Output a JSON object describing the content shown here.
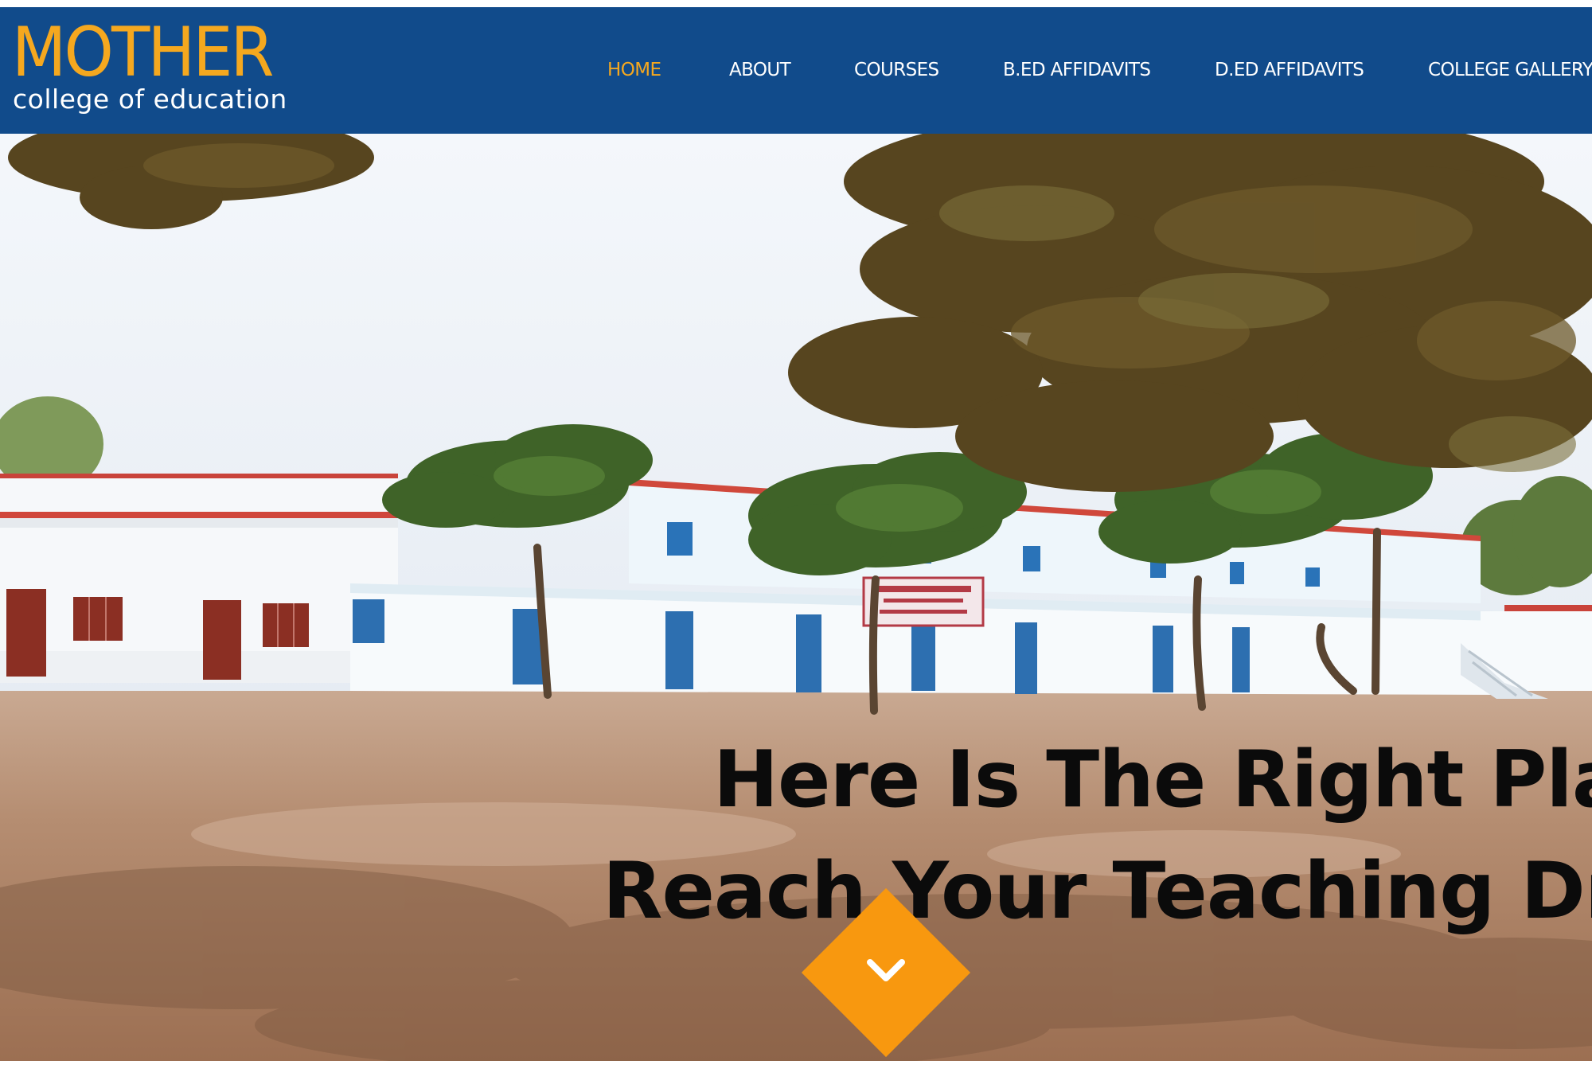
{
  "brand": {
    "name": "MOTHER",
    "tagline": "college of education",
    "accent_color": "#f5a81f",
    "bar_color": "#114b8b"
  },
  "nav": {
    "items": [
      {
        "label": "HOME",
        "active": true
      },
      {
        "label": "ABOUT",
        "active": false
      },
      {
        "label": "COURSES",
        "active": false
      },
      {
        "label": "B.ED AFFIDAVITS",
        "active": false
      },
      {
        "label": "D.ED AFFIDAVITS",
        "active": false
      },
      {
        "label": "COLLEGE GALLERY",
        "active": false
      }
    ]
  },
  "hero": {
    "headline_line_1": "Here Is The Right Place",
    "headline_line_2": "Reach Your Teaching Dream",
    "scroll_button_color": "#f8980f",
    "scroll_icon": "chevron-down-icon"
  }
}
